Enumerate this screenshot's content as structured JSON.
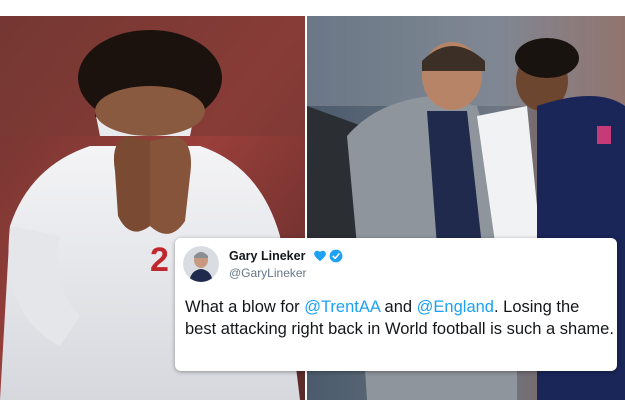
{
  "tweet": {
    "display_name": "Gary Lineker",
    "handle": "@GaryLineker",
    "text_parts": {
      "p1": "What a blow for ",
      "mention1": "@TrentAA",
      "p2": " and ",
      "mention2": "@England",
      "p3": ". Losing the best attacking right back in World football is such a shame."
    },
    "icons": [
      "heart-icon",
      "verified-badge-icon"
    ],
    "colors": {
      "mention": "#1da1f2",
      "verified": "#1da1f2",
      "heart": "#1da1f2"
    }
  },
  "images": {
    "left_photo": "player-covering-face-photo",
    "right_photo": "manager-comforting-player-photo"
  }
}
